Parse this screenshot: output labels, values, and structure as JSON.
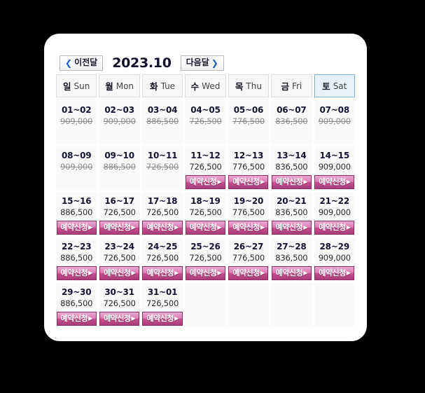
{
  "header": {
    "prev_label": "이전달",
    "prev_icon": "chevron-left-icon",
    "next_label": "다음달",
    "next_icon": "chevron-right-icon",
    "month_title": "2023.10"
  },
  "weekdays": [
    {
      "ko": "일",
      "en": "Sun"
    },
    {
      "ko": "월",
      "en": "Mon"
    },
    {
      "ko": "화",
      "en": "Tue"
    },
    {
      "ko": "수",
      "en": "Wed"
    },
    {
      "ko": "목",
      "en": "Thu"
    },
    {
      "ko": "금",
      "en": "Fri"
    },
    {
      "ko": "토",
      "en": "Sat"
    }
  ],
  "book_label": "예약신청",
  "book_arrow": "▶",
  "colors": {
    "accent_pink": "#c2508f",
    "accent_pink_border": "#8f2c63",
    "sat_highlight_bg": "#e6f2fb",
    "sat_highlight_border": "#7fb4d8",
    "cell_bg": "#fafafa",
    "panel_bg": "#ffffff",
    "page_bg": "#000000",
    "chevron_blue": "#1b5fc1",
    "disabled_price": "#8d8d8d"
  },
  "weeks": [
    [
      {
        "range": "01~02",
        "price": "909,000",
        "available": false
      },
      {
        "range": "02~03",
        "price": "909,000",
        "available": false
      },
      {
        "range": "03~04",
        "price": "886,500",
        "available": false
      },
      {
        "range": "04~05",
        "price": "726,500",
        "available": false
      },
      {
        "range": "05~06",
        "price": "776,500",
        "available": false
      },
      {
        "range": "06~07",
        "price": "836,500",
        "available": false
      },
      {
        "range": "07~08",
        "price": "909,000",
        "available": false
      }
    ],
    [
      {
        "range": "08~09",
        "price": "909,000",
        "available": false
      },
      {
        "range": "09~10",
        "price": "886,500",
        "available": false
      },
      {
        "range": "10~11",
        "price": "726,500",
        "available": false
      },
      {
        "range": "11~12",
        "price": "726,500",
        "available": true
      },
      {
        "range": "12~13",
        "price": "776,500",
        "available": true
      },
      {
        "range": "13~14",
        "price": "836,500",
        "available": true
      },
      {
        "range": "14~15",
        "price": "909,000",
        "available": true
      }
    ],
    [
      {
        "range": "15~16",
        "price": "886,500",
        "available": true
      },
      {
        "range": "16~17",
        "price": "726,500",
        "available": true
      },
      {
        "range": "17~18",
        "price": "726,500",
        "available": true
      },
      {
        "range": "18~19",
        "price": "726,500",
        "available": true
      },
      {
        "range": "19~20",
        "price": "776,500",
        "available": true
      },
      {
        "range": "20~21",
        "price": "836,500",
        "available": true
      },
      {
        "range": "21~22",
        "price": "909,000",
        "available": true
      }
    ],
    [
      {
        "range": "22~23",
        "price": "886,500",
        "available": true
      },
      {
        "range": "23~24",
        "price": "726,500",
        "available": true
      },
      {
        "range": "24~25",
        "price": "726,500",
        "available": true
      },
      {
        "range": "25~26",
        "price": "726,500",
        "available": true
      },
      {
        "range": "26~27",
        "price": "776,500",
        "available": true
      },
      {
        "range": "27~28",
        "price": "836,500",
        "available": true
      },
      {
        "range": "28~29",
        "price": "909,000",
        "available": true
      }
    ],
    [
      {
        "range": "29~30",
        "price": "886,500",
        "available": true
      },
      {
        "range": "30~31",
        "price": "726,500",
        "available": true
      },
      {
        "range": "31~01",
        "price": "726,500",
        "available": true
      },
      {
        "range": "",
        "price": "",
        "available": false,
        "empty": true
      },
      {
        "range": "",
        "price": "",
        "available": false,
        "empty": true
      },
      {
        "range": "",
        "price": "",
        "available": false,
        "empty": true
      },
      {
        "range": "",
        "price": "",
        "available": false,
        "empty": true
      }
    ]
  ]
}
